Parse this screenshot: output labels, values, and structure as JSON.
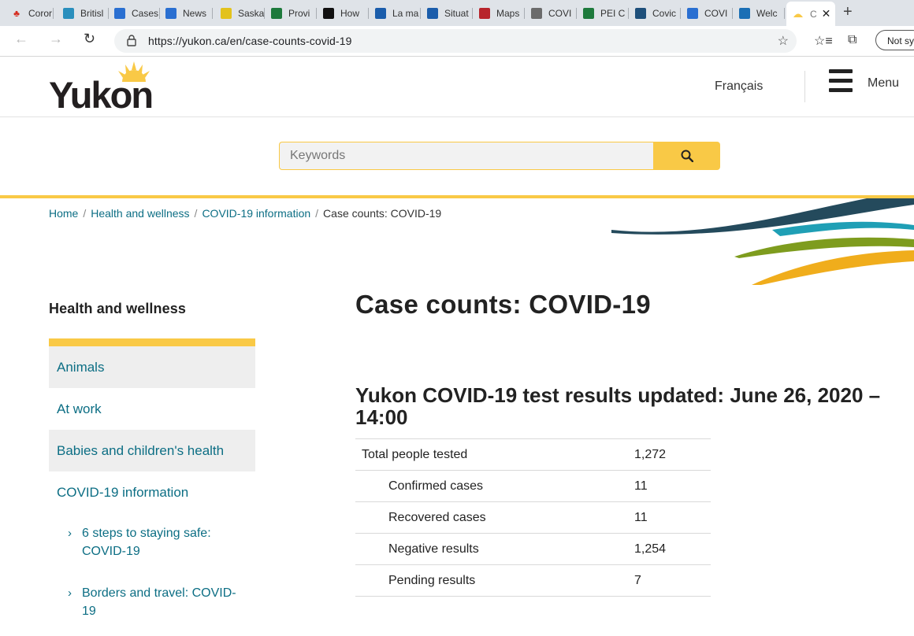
{
  "browser": {
    "tabs": [
      {
        "label": "Coror",
        "fav_color": "#ffffff",
        "fav_text": "🍁"
      },
      {
        "label": "Britisl",
        "fav_color": "#2a8fbd",
        "fav_text": "B"
      },
      {
        "label": "Cases",
        "fav_color": "#2a6fd1",
        "fav_text": "A"
      },
      {
        "label": "News",
        "fav_color": "#2a6fd1",
        "fav_text": "A"
      },
      {
        "label": "Saska",
        "fav_color": "#e3c21c",
        "fav_text": "S"
      },
      {
        "label": "Provi",
        "fav_color": "#1e7a3c",
        "fav_text": "M"
      },
      {
        "label": "How",
        "fav_color": "#111111",
        "fav_text": "O"
      },
      {
        "label": "La ma",
        "fav_color": "#1b5dab",
        "fav_text": "Q"
      },
      {
        "label": "Situat",
        "fav_color": "#1b5dab",
        "fav_text": "Q"
      },
      {
        "label": "Maps",
        "fav_color": "#b8252c",
        "fav_text": "N"
      },
      {
        "label": "COVI",
        "fav_color": "#6b6b6b",
        "fav_text": "N"
      },
      {
        "label": "PEI C",
        "fav_color": "#1e7a3c",
        "fav_text": "P"
      },
      {
        "label": "Covic",
        "fav_color": "#1e4f7a",
        "fav_text": "N"
      },
      {
        "label": "COVI",
        "fav_color": "#2a6fd1",
        "fav_text": "N"
      },
      {
        "label": "Welc",
        "fav_color": "#1b6fb5",
        "fav_text": "W"
      },
      {
        "label": "C",
        "fav_color": "#f9c946",
        "fav_text": "",
        "active": true
      }
    ],
    "new_tab": "+",
    "close_tab": "✕",
    "url": "https://yukon.ca/en/case-counts-covid-19",
    "not_synced": "Not sy"
  },
  "header": {
    "logo_text": "Yukon",
    "language_link": "Français",
    "menu_label": "Menu"
  },
  "search": {
    "placeholder": "Keywords"
  },
  "breadcrumb": {
    "items": [
      "Home",
      "Health and wellness",
      "COVID-19 information"
    ],
    "current": "Case counts: COVID-19"
  },
  "sidebar": {
    "title": "Health and wellness",
    "items": [
      {
        "label": "Animals"
      },
      {
        "label": "At work"
      },
      {
        "label": "Babies and children's health"
      },
      {
        "label": "COVID-19 information"
      }
    ],
    "subitems": [
      {
        "line1": "6 steps to staying safe:",
        "line2": "COVID-19"
      },
      {
        "line1": "Borders and travel: COVID-",
        "line2": "19"
      }
    ]
  },
  "main": {
    "title": "Case counts: COVID-19",
    "results_heading_line1": "Yukon COVID-19 test results updated: June 26, 2020 –",
    "results_heading_line2": "14:00",
    "rows": [
      {
        "label": "Total people tested",
        "value": "1,272"
      },
      {
        "label": "Confirmed cases",
        "value": "11"
      },
      {
        "label": "Recovered cases",
        "value": "11"
      },
      {
        "label": "Negative results",
        "value": "1,254"
      },
      {
        "label": "Pending results",
        "value": "7"
      }
    ]
  },
  "colors": {
    "brand_yellow": "#f9c946",
    "link_teal": "#0c6e84",
    "swoosh_navy": "#244a5c",
    "swoosh_teal": "#1f9fb5",
    "swoosh_green": "#7e9c1e",
    "swoosh_gold": "#f0ad1c"
  }
}
